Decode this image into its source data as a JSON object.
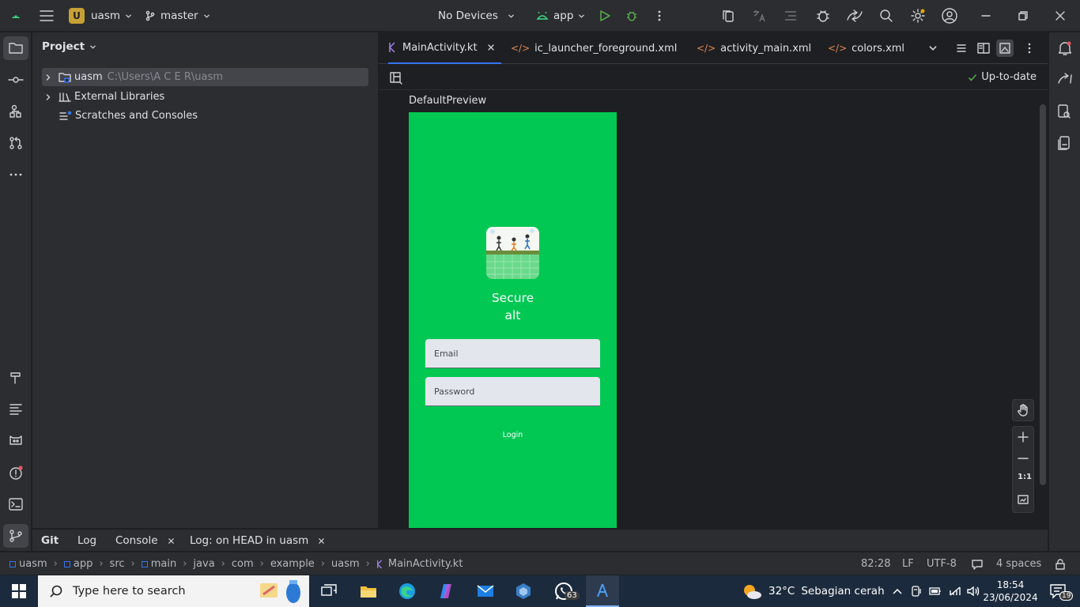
{
  "titlebar": {
    "project_initial": "U",
    "project_name": "uasm",
    "branch": "master",
    "devices": "No Devices",
    "run_config": "app"
  },
  "project_panel": {
    "title": "Project",
    "tree": [
      {
        "name": "uasm",
        "path": "C:\\Users\\A C E R\\uasm"
      },
      {
        "name": "External Libraries"
      },
      {
        "name": "Scratches and Consoles"
      }
    ]
  },
  "editor": {
    "tabs": [
      {
        "label": "MainActivity.kt",
        "active": true
      },
      {
        "label": "ic_launcher_foreground.xml"
      },
      {
        "label": "activity_main.xml"
      },
      {
        "label": "colors.xml"
      }
    ],
    "status": "Up-to-date",
    "preview_name": "DefaultPreview",
    "zoom_reset": "1:1"
  },
  "phone": {
    "background": "#00c853",
    "title_line1": "Secure",
    "title_line2": "alt",
    "email_placeholder": "Email",
    "password_placeholder": "Password",
    "login_label": "Login"
  },
  "bottom_tabs": [
    "Git",
    "Log",
    "Console",
    "Log: on HEAD in uasm"
  ],
  "breadcrumb": [
    "uasm",
    "app",
    "src",
    "main",
    "java",
    "com",
    "example",
    "uasm",
    "MainActivity.kt"
  ],
  "statusbar": {
    "position": "82:28",
    "line_ending": "LF",
    "encoding": "UTF-8",
    "indent": "4 spaces"
  },
  "taskbar": {
    "search_placeholder": "Type here to search",
    "whatsapp_badge": "63",
    "weather_temp": "32°C",
    "weather_desc": "Sebagian cerah",
    "time": "18:54",
    "date": "23/06/2024",
    "notification_count": "19"
  },
  "colors": {
    "accent": "#3574f0",
    "phone_green": "#00c853",
    "ide_bg": "#1e1f22",
    "panel_bg": "#2b2d30"
  }
}
